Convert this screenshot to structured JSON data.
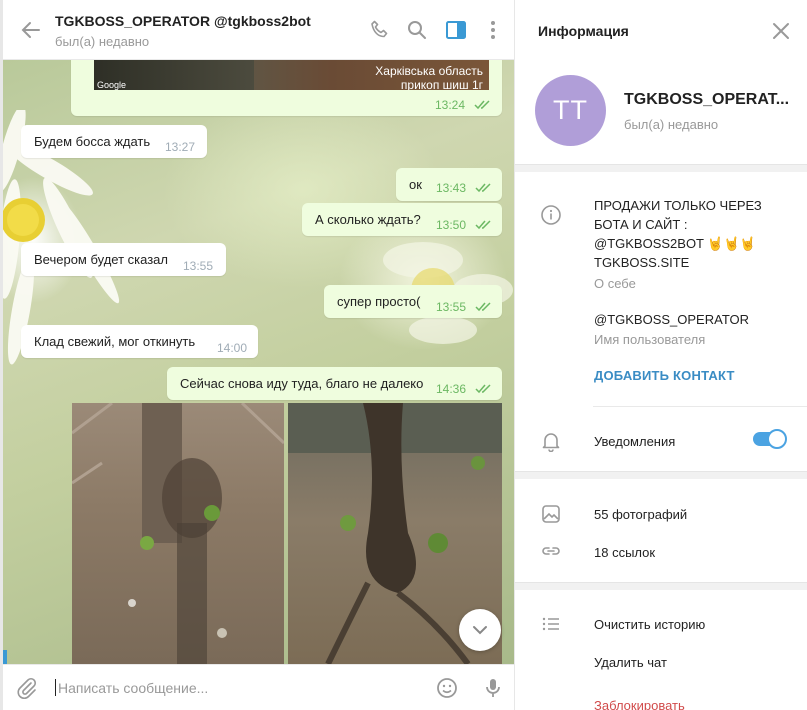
{
  "chat_header": {
    "title": "TGKBOSS_OPERATOR @tgkboss2bot",
    "subtitle": "был(а) недавно"
  },
  "messages": [
    {
      "dir": "out",
      "type": "location",
      "map_line1": "Харківська область",
      "map_line2": "прикоп шиш 1г",
      "map_brand": "Google",
      "time": "13:24"
    },
    {
      "dir": "in",
      "text": "Будем босса ждать",
      "time": "13:27"
    },
    {
      "dir": "out",
      "text": "ок",
      "time": "13:43"
    },
    {
      "dir": "out",
      "text": "А сколько ждать?",
      "time": "13:50"
    },
    {
      "dir": "in",
      "text": "Вечером будет сказал",
      "time": "13:55"
    },
    {
      "dir": "out",
      "text": "супер просто(",
      "time": "13:55"
    },
    {
      "dir": "in",
      "text": "Клад свежий, мог откинуть",
      "time": "14:00"
    },
    {
      "dir": "out",
      "text": "Сейчас снова иду туда, благо не далеко",
      "time": "14:36"
    }
  ],
  "composer": {
    "placeholder": "Написать сообщение..."
  },
  "info_panel": {
    "title": "Информация",
    "avatar_initials": "TT",
    "name": "TGKBOSS_OPERAT...",
    "status": "был(а) недавно",
    "bio_line1": "ПРОДАЖИ ТОЛЬКО ЧЕРЕЗ",
    "bio_line2": "БОТА И САЙТ :",
    "bio_line3": "@TGKBOSS2BOT 🤘🤘🤘",
    "bio_line4": "TGKBOSS.SITE",
    "bio_label": "О себе",
    "username": "@TGKBOSS_OPERATOR",
    "username_label": "Имя пользователя",
    "add_contact": "ДОБАВИТЬ КОНТАКТ",
    "notifications_label": "Уведомления",
    "notifications_on": true,
    "photos": "55 фотографий",
    "links": "18 ссылок",
    "clear_history": "Очистить историю",
    "delete_chat": "Удалить чат",
    "block": "Заблокировать"
  },
  "colors": {
    "accent": "#4ba3e2",
    "outgoing_bubble": "#effdde",
    "outgoing_time": "#6cb863",
    "avatar": "#b09ed8",
    "danger": "#d14b4b"
  }
}
